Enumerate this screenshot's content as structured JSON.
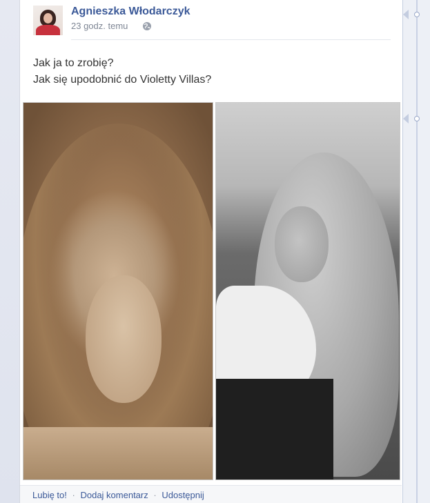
{
  "post": {
    "author": "Agnieszka Włodarczyk",
    "timestamp": "23 godz. temu",
    "privacy_icon": "globe-icon",
    "lines": [
      "Jak ja to zrobię?",
      "Jak się upodobnić do Violetty Villas?"
    ]
  },
  "actions": {
    "like": "Lubię to!",
    "comment": "Dodaj komentarz",
    "share": "Udostępnij",
    "separator": "·"
  },
  "colors": {
    "link": "#3b5998",
    "muted": "#7f8795",
    "background": "#e9ebee"
  }
}
